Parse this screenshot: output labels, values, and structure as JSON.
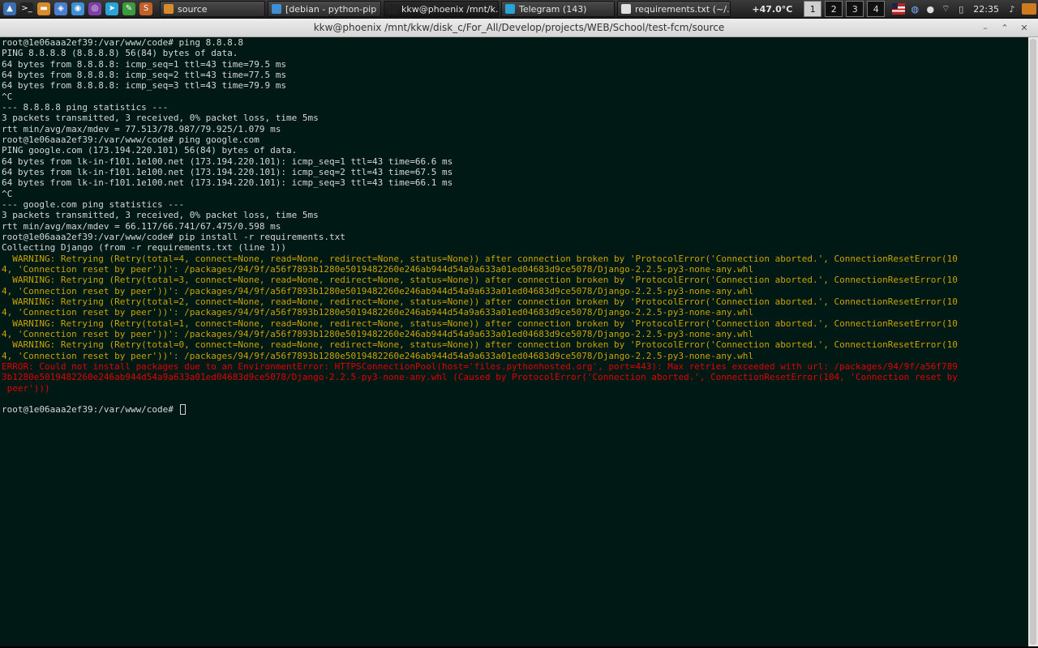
{
  "taskbar": {
    "launcher_icons": [
      {
        "name": "menu-icon",
        "glyph": "▲",
        "color": "#3a6fb5"
      },
      {
        "name": "terminal-icon",
        "glyph": ">_",
        "color": "#222222"
      },
      {
        "name": "folder-icon",
        "glyph": "▬",
        "color": "#d98a2c"
      },
      {
        "name": "app-icon",
        "glyph": "◈",
        "color": "#4a7fcf"
      },
      {
        "name": "browser-icon",
        "glyph": "◉",
        "color": "#3d8fd6"
      },
      {
        "name": "tor-icon",
        "glyph": "◎",
        "color": "#7d3fa8"
      },
      {
        "name": "telegram-icon",
        "glyph": "➤",
        "color": "#2aa3d8"
      },
      {
        "name": "chat-icon",
        "glyph": "✎",
        "color": "#3c9b3c"
      },
      {
        "name": "sublime-icon",
        "glyph": "S",
        "color": "#c0602a"
      }
    ],
    "tasks": [
      {
        "label": "source",
        "icon": "folder-icon",
        "icon_color": "#d98a2c",
        "active": false
      },
      {
        "label": "[debian - python-pip ...",
        "icon": "browser-icon",
        "icon_color": "#3d8fd6",
        "active": false
      },
      {
        "label": "kkw@phoenix /mnt/k...",
        "icon": "terminal-icon",
        "icon_color": "#222222",
        "active": true
      },
      {
        "label": "Telegram (143)",
        "icon": "telegram-icon",
        "icon_color": "#2aa3d8",
        "active": false
      },
      {
        "label": "requirements.txt (~/...",
        "icon": "text-file-icon",
        "icon_color": "#e0e0e0",
        "active": false
      }
    ],
    "temperature": "+47.0°C",
    "desktops": [
      "1",
      "2",
      "3",
      "4"
    ],
    "current_desktop": "1",
    "clock": "22:35"
  },
  "window": {
    "title": "kkw@phoenix /mnt/kkw/disk_c/For_All/Develop/projects/WEB/School/test-fcm/source"
  },
  "terminal": {
    "background": "#001915",
    "lines": [
      {
        "text": "root@1e06aaa2ef39:/var/www/code# ping 8.8.8.8",
        "kind": "normal"
      },
      {
        "text": "PING 8.8.8.8 (8.8.8.8) 56(84) bytes of data.",
        "kind": "normal"
      },
      {
        "text": "64 bytes from 8.8.8.8: icmp_seq=1 ttl=43 time=79.5 ms",
        "kind": "normal"
      },
      {
        "text": "64 bytes from 8.8.8.8: icmp_seq=2 ttl=43 time=77.5 ms",
        "kind": "normal"
      },
      {
        "text": "64 bytes from 8.8.8.8: icmp_seq=3 ttl=43 time=79.9 ms",
        "kind": "normal"
      },
      {
        "text": "^C",
        "kind": "normal"
      },
      {
        "text": "--- 8.8.8.8 ping statistics ---",
        "kind": "normal"
      },
      {
        "text": "3 packets transmitted, 3 received, 0% packet loss, time 5ms",
        "kind": "normal"
      },
      {
        "text": "rtt min/avg/max/mdev = 77.513/78.987/79.925/1.079 ms",
        "kind": "normal"
      },
      {
        "text": "root@1e06aaa2ef39:/var/www/code# ping google.com",
        "kind": "normal"
      },
      {
        "text": "PING google.com (173.194.220.101) 56(84) bytes of data.",
        "kind": "normal"
      },
      {
        "text": "64 bytes from lk-in-f101.1e100.net (173.194.220.101): icmp_seq=1 ttl=43 time=66.6 ms",
        "kind": "normal"
      },
      {
        "text": "64 bytes from lk-in-f101.1e100.net (173.194.220.101): icmp_seq=2 ttl=43 time=67.5 ms",
        "kind": "normal"
      },
      {
        "text": "64 bytes from lk-in-f101.1e100.net (173.194.220.101): icmp_seq=3 ttl=43 time=66.1 ms",
        "kind": "normal"
      },
      {
        "text": "^C",
        "kind": "normal"
      },
      {
        "text": "--- google.com ping statistics ---",
        "kind": "normal"
      },
      {
        "text": "3 packets transmitted, 3 received, 0% packet loss, time 5ms",
        "kind": "normal"
      },
      {
        "text": "rtt min/avg/max/mdev = 66.117/66.741/67.475/0.598 ms",
        "kind": "normal"
      },
      {
        "text": "root@1e06aaa2ef39:/var/www/code# pip install -r requirements.txt",
        "kind": "normal"
      },
      {
        "text": "Collecting Django (from -r requirements.txt (line 1))",
        "kind": "normal"
      },
      {
        "text": "  WARNING: Retrying (Retry(total=4, connect=None, read=None, redirect=None, status=None)) after connection broken by 'ProtocolError('Connection aborted.', ConnectionResetError(10",
        "kind": "warn"
      },
      {
        "text": "4, 'Connection reset by peer'))': /packages/94/9f/a56f7893b1280e5019482260e246ab944d54a9a633a01ed04683d9ce5078/Django-2.2.5-py3-none-any.whl",
        "kind": "warn"
      },
      {
        "text": "  WARNING: Retrying (Retry(total=3, connect=None, read=None, redirect=None, status=None)) after connection broken by 'ProtocolError('Connection aborted.', ConnectionResetError(10",
        "kind": "warn"
      },
      {
        "text": "4, 'Connection reset by peer'))': /packages/94/9f/a56f7893b1280e5019482260e246ab944d54a9a633a01ed04683d9ce5078/Django-2.2.5-py3-none-any.whl",
        "kind": "warn"
      },
      {
        "text": "  WARNING: Retrying (Retry(total=2, connect=None, read=None, redirect=None, status=None)) after connection broken by 'ProtocolError('Connection aborted.', ConnectionResetError(10",
        "kind": "warn"
      },
      {
        "text": "4, 'Connection reset by peer'))': /packages/94/9f/a56f7893b1280e5019482260e246ab944d54a9a633a01ed04683d9ce5078/Django-2.2.5-py3-none-any.whl",
        "kind": "warn"
      },
      {
        "text": "  WARNING: Retrying (Retry(total=1, connect=None, read=None, redirect=None, status=None)) after connection broken by 'ProtocolError('Connection aborted.', ConnectionResetError(10",
        "kind": "warn"
      },
      {
        "text": "4, 'Connection reset by peer'))': /packages/94/9f/a56f7893b1280e5019482260e246ab944d54a9a633a01ed04683d9ce5078/Django-2.2.5-py3-none-any.whl",
        "kind": "warn"
      },
      {
        "text": "  WARNING: Retrying (Retry(total=0, connect=None, read=None, redirect=None, status=None)) after connection broken by 'ProtocolError('Connection aborted.', ConnectionResetError(10",
        "kind": "warn"
      },
      {
        "text": "4, 'Connection reset by peer'))': /packages/94/9f/a56f7893b1280e5019482260e246ab944d54a9a633a01ed04683d9ce5078/Django-2.2.5-py3-none-any.whl",
        "kind": "warn"
      },
      {
        "text": "ERROR: Could not install packages due to an EnvironmentError: HTTPSConnectionPool(host='files.pythonhosted.org', port=443): Max retries exceeded with url: /packages/94/9f/a56f789",
        "kind": "err"
      },
      {
        "text": "3b1280e5019482260e246ab944d54a9a633a01ed04683d9ce5078/Django-2.2.5-py3-none-any.whl (Caused by ProtocolError('Connection aborted.', ConnectionResetError(104, 'Connection reset by",
        "kind": "err"
      },
      {
        "text": " peer')))",
        "kind": "err"
      },
      {
        "text": "",
        "kind": "normal"
      },
      {
        "text": "root@1e06aaa2ef39:/var/www/code# ",
        "kind": "prompt"
      }
    ]
  }
}
